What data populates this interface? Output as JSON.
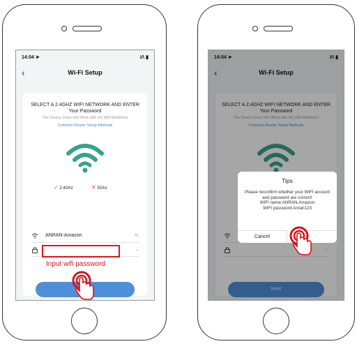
{
  "status_bar": {
    "time": "14:04 ➤",
    "icons": "⧘ⴷ ▮"
  },
  "nav": {
    "back": "‹",
    "title": "Wi-Fi Setup"
  },
  "setup": {
    "heading": "SELECT A 2.4GHZ WIFI NETWORK AND ENTER Your Password",
    "note": "The Device Does Not Work with 5G Wifi NetWorks",
    "link": "Common Router Setup Methods",
    "band_ok": "2.4Ghz",
    "band_bad": "5Ghz",
    "network_name": "ANRAN-Amazon",
    "next_label": "Next"
  },
  "annotation": {
    "label": "Input wifi password"
  },
  "dialog": {
    "title": "Tips",
    "message": "Please reconfirm whether your WIFI account and password are correct!",
    "wifi_name": "WIFI name:ANRAN-Amazon",
    "wifi_password": "WIFI password:Anran123",
    "cancel_label": "Cancel"
  },
  "colors": {
    "accent": "#4f8fd9",
    "wifi_green": "#36a38b",
    "annotation_red": "#e0121b"
  },
  "icons": [
    "wifi-icon",
    "lock-icon",
    "tap-hand-icon",
    "check-icon",
    "cross-icon",
    "back-icon"
  ]
}
